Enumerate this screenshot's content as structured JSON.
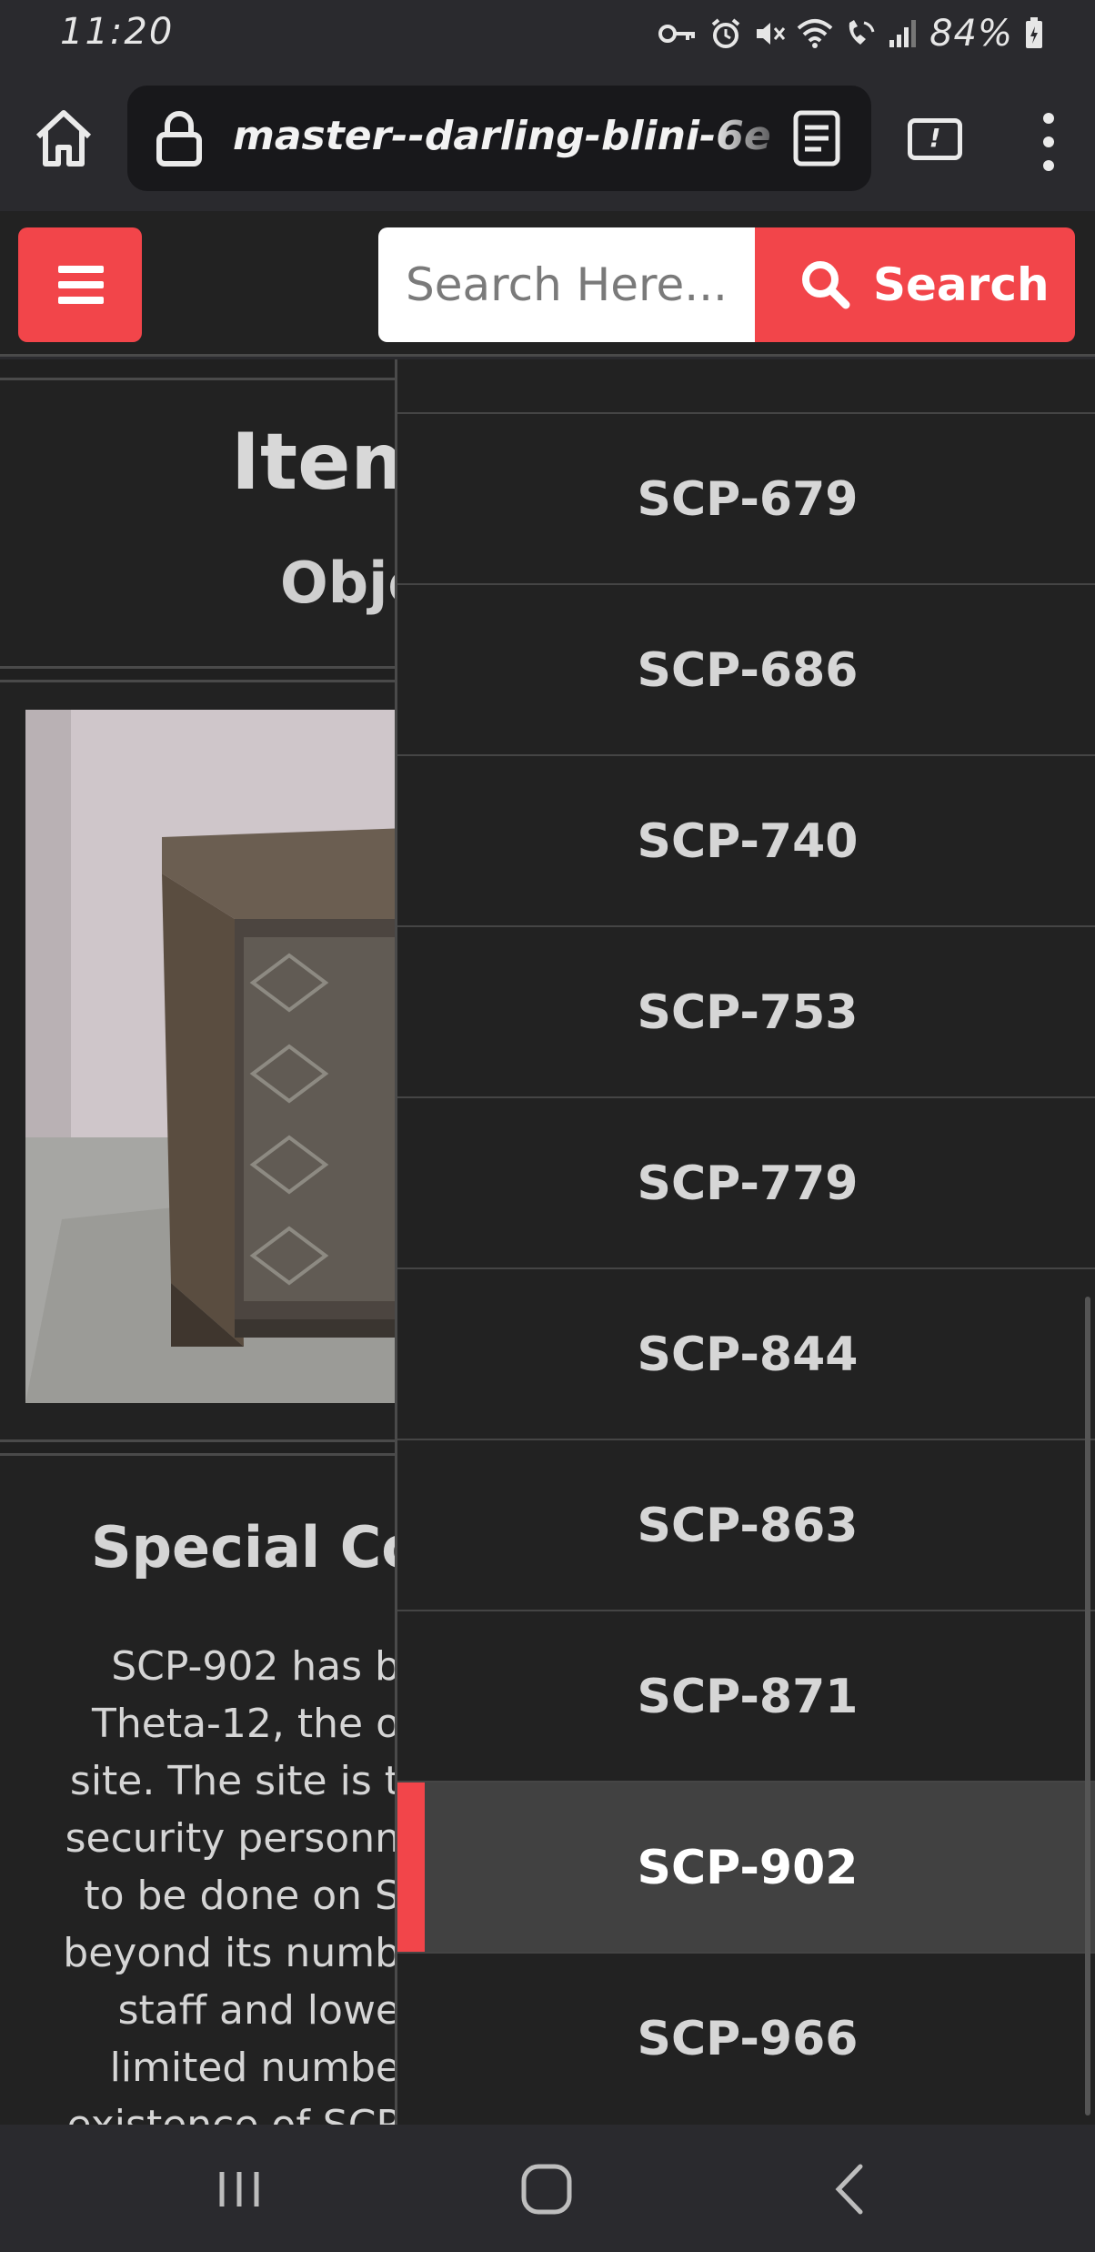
{
  "status_bar": {
    "time": "11:20",
    "battery": "84%",
    "icons": [
      "key-icon",
      "alarm-icon",
      "mute-icon",
      "wifi-icon",
      "wifi-calling-icon",
      "signal-icon",
      "battery-icon"
    ]
  },
  "browser": {
    "url": "master--darling-blini-6eb",
    "tab_count": "!"
  },
  "header": {
    "search_placeholder": "Search Here...",
    "search_label": "Search",
    "accent_color": "#f2454a"
  },
  "page": {
    "item_title": "Item",
    "object_class": "Obje",
    "containment_heading": "Special Con",
    "containment_lines": [
      "SCP-902 has b",
      "Theta-12, the o",
      "site. The site is t",
      "security personn",
      "to be done on S",
      "beyond its numb",
      "staff and lowe",
      "limited numbe",
      "existence of SCP"
    ]
  },
  "drawer": {
    "items": [
      {
        "label": "SCP-679",
        "active": false
      },
      {
        "label": "SCP-686",
        "active": false
      },
      {
        "label": "SCP-740",
        "active": false
      },
      {
        "label": "SCP-753",
        "active": false
      },
      {
        "label": "SCP-779",
        "active": false
      },
      {
        "label": "SCP-844",
        "active": false
      },
      {
        "label": "SCP-863",
        "active": false
      },
      {
        "label": "SCP-871",
        "active": false
      },
      {
        "label": "SCP-902",
        "active": true
      },
      {
        "label": "SCP-966",
        "active": false
      }
    ]
  }
}
